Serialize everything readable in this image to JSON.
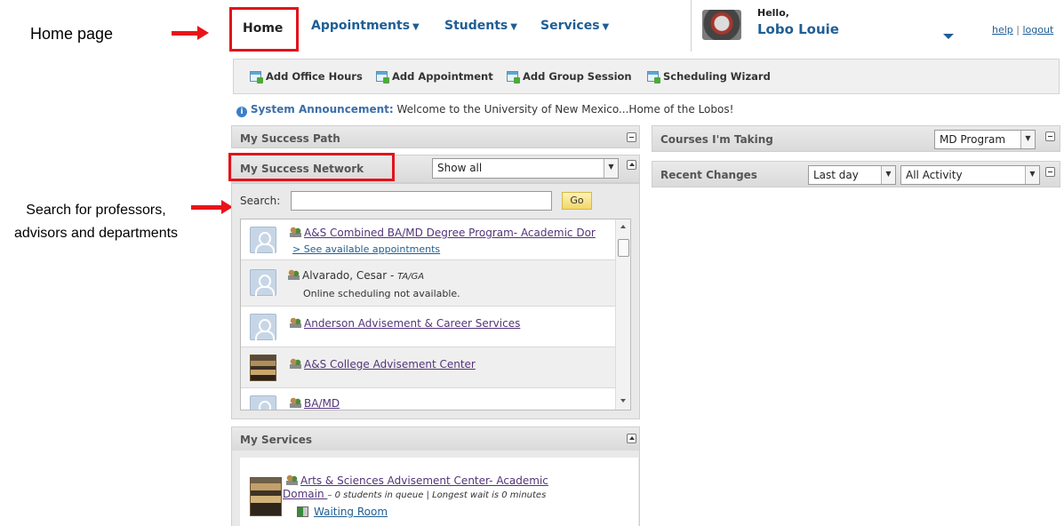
{
  "annotations": {
    "home_page": "Home page",
    "search_note": "Search for professors, advisors and departments"
  },
  "nav": {
    "home": "Home",
    "items": [
      "Appointments",
      "Students",
      "Services"
    ],
    "greeting": "Hello,",
    "user_name": "Lobo Louie",
    "help": "help",
    "separator": "|",
    "logout": "logout"
  },
  "toolbar": {
    "items": [
      "Add Office Hours",
      "Add Appointment",
      "Add Group Session",
      "Scheduling Wizard"
    ]
  },
  "announcement": {
    "label": "System Announcement:",
    "text": "Welcome to the University of New Mexico...Home of the Lobos!"
  },
  "left": {
    "success_path": {
      "title": "My Success Path"
    },
    "success_network": {
      "title": "My Success Network",
      "filter_value": "Show all",
      "search_label": "Search:",
      "search_value": "",
      "go_label": "Go",
      "items": [
        {
          "name": "A&S Combined BA/MD Degree Program- Academic Dor",
          "sub": "> See available appointments"
        },
        {
          "name": "Alvarado, Cesar - ",
          "role": "TA/GA",
          "sub": "Online scheduling not available."
        },
        {
          "name": "Anderson Advisement & Career Services"
        },
        {
          "name": "A&S College Advisement Center"
        },
        {
          "name": "BA/MD"
        }
      ]
    },
    "services": {
      "title": "My Services",
      "item_line1": "Arts & Sciences Advisement Center- Academic",
      "item_line2": "Domain ",
      "item_meta": "– 0 students in queue | Longest wait is 0 minutes",
      "waiting_room": "Waiting Room"
    }
  },
  "right": {
    "courses": {
      "title": "Courses I'm Taking",
      "program": "MD Program"
    },
    "recent": {
      "title": "Recent Changes",
      "period": "Last day",
      "activity": "All Activity"
    }
  }
}
